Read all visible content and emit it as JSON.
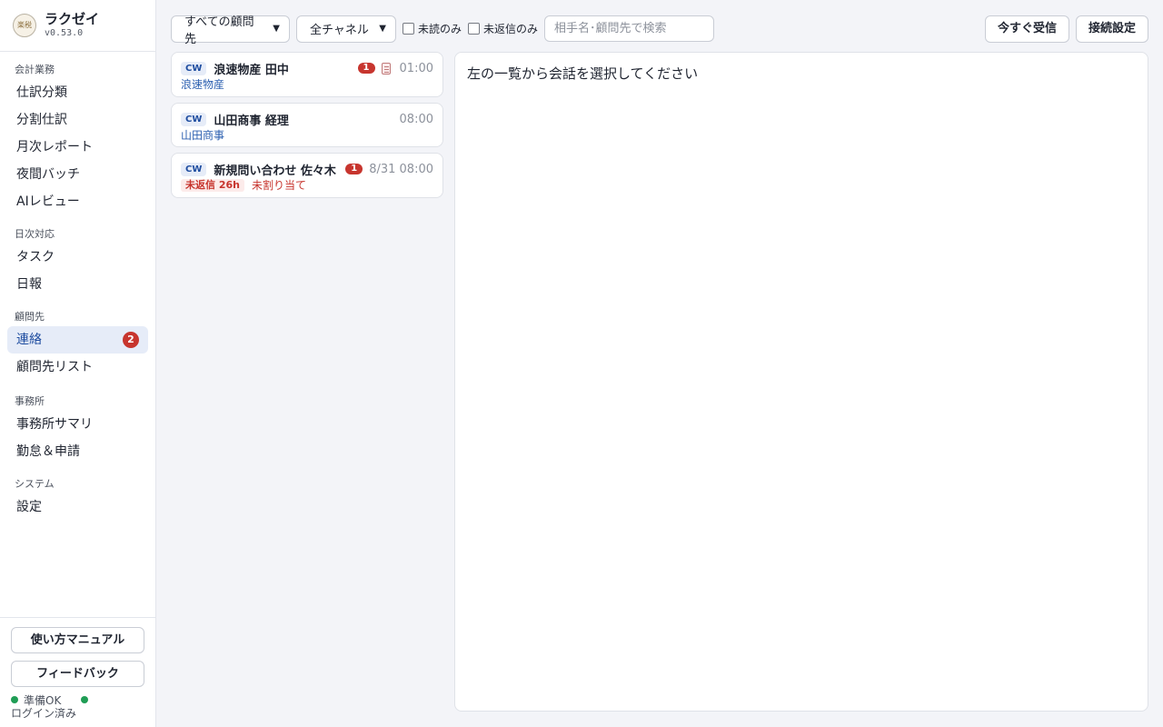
{
  "brand": {
    "name": "ラクゼイ",
    "version": "v0.53.0",
    "logo_text": "楽税"
  },
  "sidebar": {
    "sections": [
      {
        "title": "会計業務",
        "items": [
          {
            "label": "仕訳分類"
          },
          {
            "label": "分割仕訳"
          },
          {
            "label": "月次レポート"
          },
          {
            "label": "夜間バッチ"
          },
          {
            "label": "AIレビュー"
          }
        ]
      },
      {
        "title": "日次対応",
        "items": [
          {
            "label": "タスク"
          },
          {
            "label": "日報"
          }
        ]
      },
      {
        "title": "顧問先",
        "items": [
          {
            "label": "連絡",
            "badge": "2",
            "active": true
          },
          {
            "label": "顧問先リスト"
          }
        ]
      },
      {
        "title": "事務所",
        "items": [
          {
            "label": "事務所サマリ"
          },
          {
            "label": "勤怠＆申請"
          }
        ]
      },
      {
        "title": "システム",
        "items": [
          {
            "label": "設定"
          }
        ]
      }
    ],
    "bottom": {
      "manual_label": "使い方マニュアル",
      "feedback_label": "フィードバック",
      "status_text": "準備OK",
      "login_text": "ログイン済み"
    }
  },
  "toolbar": {
    "client_filter": "すべての顧問先",
    "channel_filter": "全チャネル",
    "unread_only": "未読のみ",
    "unreplied_only": "未返信のみ",
    "search_placeholder": "相手名･顧問先で検索",
    "receive_now": "今すぐ受信",
    "connection_settings": "接続設定"
  },
  "conversations": [
    {
      "channel": "CW",
      "name": "浪速物産 田中",
      "unread": "1",
      "has_memo": true,
      "time": "01:00",
      "client": "浪速物産"
    },
    {
      "channel": "CW",
      "name": "山田商事 経理",
      "time": "08:00",
      "client": "山田商事"
    },
    {
      "channel": "CW",
      "name": "新規問い合わせ 佐々木",
      "unread": "1",
      "time": "8/31 08:00",
      "overdue": "未返信 26h",
      "assignment": "未割り当て"
    }
  ],
  "detail": {
    "placeholder": "左の一覧から会話を選択してください"
  },
  "colors": {
    "accent": "#1f4da0",
    "danger": "#c7352e",
    "ok": "#1f9d55"
  }
}
